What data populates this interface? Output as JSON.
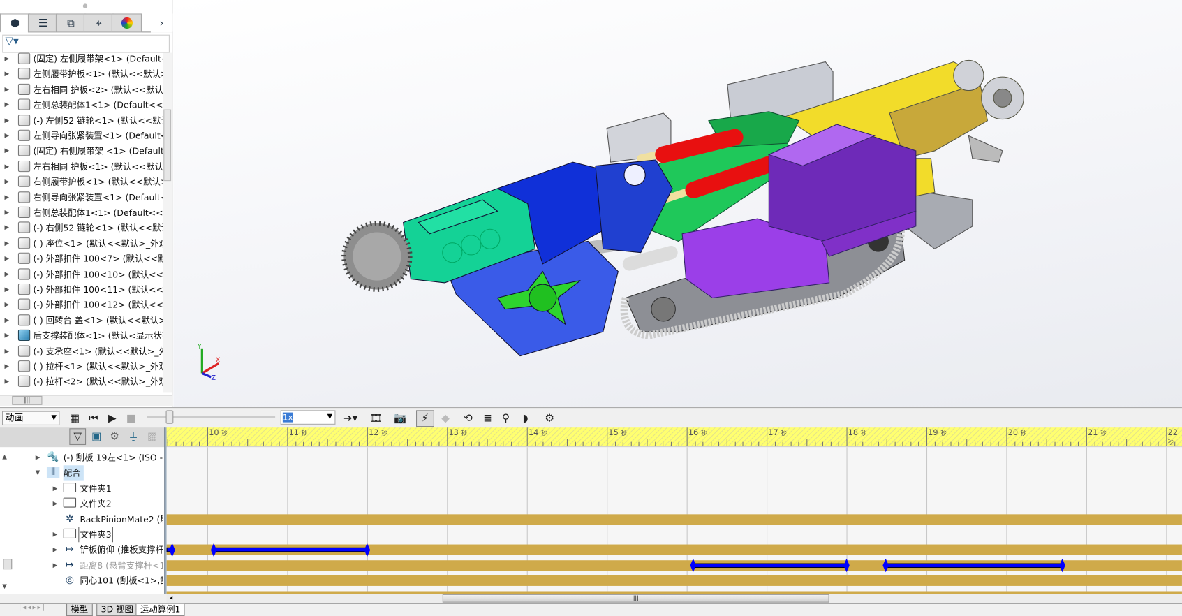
{
  "feature_tree": {
    "tabs": [
      "featuremanager-icon",
      "propertymanager-icon",
      "configurationmanager-icon",
      "dimxpert-icon",
      "display-manager-icon"
    ],
    "items": [
      {
        "label": "(固定) 左侧履带架<1> (Default<-"
      },
      {
        "label": "左侧履带护板<1> (默认<<默认>_"
      },
      {
        "label": "左右相同  护板<2> (默认<<默认:"
      },
      {
        "label": "左侧总装配体1<1> (Default<<De"
      },
      {
        "label": "(-) 左侧52  链轮<1> (默认<<默认"
      },
      {
        "label": "左侧导向张紧装置<1> (Default<-"
      },
      {
        "label": "(固定) 右侧履带架 <1> (Default<"
      },
      {
        "label": "左右相同  护板<1> (默认<<默认:"
      },
      {
        "label": "右侧履带护板<1> (默认<<默认>_"
      },
      {
        "label": "右侧导向张紧装置<1> (Default<-"
      },
      {
        "label": "右侧总装配体1<1> (Default<<De"
      },
      {
        "label": "(-) 右侧52  链轮<1> (默认<<默认"
      },
      {
        "label": "(-) 座位<1> (默认<<默认>_外观"
      },
      {
        "label": "(-) 外部扣件  100<7> (默认<<默"
      },
      {
        "label": "(-) 外部扣件  100<10> (默认<<默"
      },
      {
        "label": "(-) 外部扣件  100<11> (默认<<默"
      },
      {
        "label": "(-) 外部扣件  100<12> (默认<<默"
      },
      {
        "label": "(-) 回转台 盖<1> (默认<<默认>_"
      },
      {
        "label": "后支撑装配体<1> (默认<显示状态",
        "icon": "blue"
      },
      {
        "label": "(-) 支承座<1> (默认<<默认>_外观"
      },
      {
        "label": "(-) 拉杆<1> (默认<<默认>_外观"
      },
      {
        "label": "(-) 拉杆<2> (默认<<默认>_外观"
      }
    ]
  },
  "motion": {
    "study_type": "动画",
    "playback_speed": "1x",
    "time_unit": "秒",
    "ruler_labels": [
      "10",
      "11",
      "12",
      "13",
      "14",
      "15",
      "16",
      "17",
      "18",
      "19",
      "20",
      "21",
      "22"
    ],
    "tree": [
      {
        "label": "(-) 刮板 19左<1> (ISO - I",
        "icon": "bolt",
        "indent": 0,
        "arrow": "▶"
      },
      {
        "label": "配合",
        "icon": "mates",
        "indent": 0,
        "arrow": "▼",
        "selected": true
      },
      {
        "label": "文件夹1",
        "icon": "folder",
        "indent": 1,
        "arrow": "▶"
      },
      {
        "label": "文件夹2",
        "icon": "folder",
        "indent": 1,
        "arrow": "▶"
      },
      {
        "label": "RackPinionMate2 (履",
        "icon": "rack-pinion",
        "indent": 1,
        "arrow": ""
      },
      {
        "label": "文件夹3",
        "icon": "folder",
        "indent": 1,
        "arrow": "▶",
        "boxed": true
      },
      {
        "label": "铲板俯仰 (推板支撑杆",
        "icon": "distance",
        "indent": 1,
        "arrow": "▶"
      },
      {
        "label": "距离8 (悬臂支撑杆<1:",
        "icon": "distance",
        "indent": 1,
        "arrow": "▶",
        "dim": true
      },
      {
        "label": "同心101 (刮板<1>,刮",
        "icon": "concentric",
        "indent": 1,
        "arrow": ""
      }
    ],
    "timeline_rows": [
      {
        "bar": false,
        "keys": [],
        "segments": []
      },
      {
        "bar": false,
        "keys": [],
        "segments": []
      },
      {
        "bar": false,
        "keys": [],
        "segments": []
      },
      {
        "bar": false,
        "keys": [],
        "segments": []
      },
      {
        "bar": true,
        "keys": [],
        "segments": []
      },
      {
        "bar": false,
        "keys": [],
        "segments": []
      },
      {
        "bar": true,
        "keys": [
          9.56,
          10.08,
          12.0
        ],
        "segments": [
          [
            9.49,
            9.56
          ],
          [
            10.08,
            12.0
          ]
        ]
      },
      {
        "bar": true,
        "keys": [
          16.08,
          18.0,
          18.49,
          20.7
        ],
        "segments": [
          [
            16.08,
            18.0
          ],
          [
            18.49,
            20.7
          ]
        ]
      },
      {
        "bar": true,
        "keys": [],
        "segments": []
      },
      {
        "bar": true,
        "keys": [],
        "segments": []
      }
    ],
    "view_start_seconds": 9.49,
    "colors": {
      "bar": "#cfaa4a",
      "segment": "#0000ff",
      "ruler": "#ffff70"
    }
  },
  "bottom_tabs": [
    "模型",
    "3D 视图",
    "运动算例1"
  ],
  "triad": {
    "x": "X",
    "y": "Y",
    "z": "Z"
  }
}
